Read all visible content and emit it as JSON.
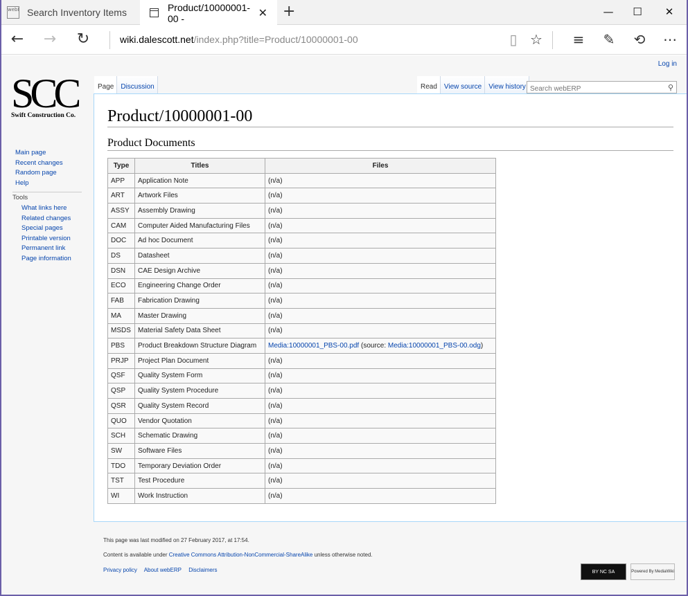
{
  "browser": {
    "tabs": [
      {
        "title": "Search Inventory Items",
        "favicon": "webERP"
      },
      {
        "title": "Product/10000001-00 -"
      }
    ],
    "address": {
      "host": "wiki.dalescott.net",
      "path": "/index.php?title=Product/10000001-00"
    }
  },
  "wiki": {
    "login": "Log in",
    "logo": {
      "big": "SCC",
      "small": "Swift Construction Co."
    },
    "nav": [
      "Main page",
      "Recent changes",
      "Random page",
      "Help"
    ],
    "tools_heading": "Tools",
    "tools": [
      "What links here",
      "Related changes",
      "Special pages",
      "Printable version",
      "Permanent link",
      "Page information"
    ],
    "left_tabs": [
      "Page",
      "Discussion"
    ],
    "right_tabs": [
      "Read",
      "View source",
      "View history"
    ],
    "search_placeholder": "Search webERP",
    "title": "Product/10000001-00",
    "section": "Product Documents",
    "table": {
      "headers": [
        "Type",
        "Titles",
        "Files"
      ],
      "rows": [
        {
          "type": "APP",
          "title": "Application Note",
          "files": "(n/a)"
        },
        {
          "type": "ART",
          "title": "Artwork Files",
          "files": "(n/a)"
        },
        {
          "type": "ASSY",
          "title": "Assembly Drawing",
          "files": "(n/a)"
        },
        {
          "type": "CAM",
          "title": "Computer Aided Manufacturing Files",
          "files": "(n/a)"
        },
        {
          "type": "DOC",
          "title": "Ad hoc Document",
          "files": "(n/a)"
        },
        {
          "type": "DS",
          "title": "Datasheet",
          "files": "(n/a)"
        },
        {
          "type": "DSN",
          "title": "CAE Design Archive",
          "files": "(n/a)"
        },
        {
          "type": "ECO",
          "title": "Engineering Change Order",
          "files": "(n/a)"
        },
        {
          "type": "FAB",
          "title": "Fabrication Drawing",
          "files": "(n/a)"
        },
        {
          "type": "MA",
          "title": "Master Drawing",
          "files": "(n/a)"
        },
        {
          "type": "MSDS",
          "title": "Material Safety Data Sheet",
          "files": "(n/a)"
        },
        {
          "type": "PBS",
          "title": "Product Breakdown Structure Diagram",
          "files": "",
          "link1": "Media:10000001_PBS-00.pdf",
          "mid": " (source: ",
          "link2": "Media:10000001_PBS-00.odg",
          "end": ")"
        },
        {
          "type": "PRJP",
          "title": "Project Plan Document",
          "files": "(n/a)"
        },
        {
          "type": "QSF",
          "title": "Quality System Form",
          "files": "(n/a)"
        },
        {
          "type": "QSP",
          "title": "Quality System Procedure",
          "files": "(n/a)"
        },
        {
          "type": "QSR",
          "title": "Quality System Record",
          "files": "(n/a)"
        },
        {
          "type": "QUO",
          "title": "Vendor Quotation",
          "files": "(n/a)"
        },
        {
          "type": "SCH",
          "title": "Schematic Drawing",
          "files": "(n/a)"
        },
        {
          "type": "SW",
          "title": "Software Files",
          "files": "(n/a)"
        },
        {
          "type": "TDO",
          "title": "Temporary Deviation Order",
          "files": "(n/a)"
        },
        {
          "type": "TST",
          "title": "Test Procedure",
          "files": "(n/a)"
        },
        {
          "type": "WI",
          "title": "Work Instruction",
          "files": "(n/a)"
        }
      ]
    },
    "footer": {
      "modified": "This page was last modified on 27 February 2017, at 17:54.",
      "content_prefix": "Content is available under ",
      "license": "Creative Commons Attribution-NonCommercial-ShareAlike",
      "content_suffix": " unless otherwise noted.",
      "links": [
        "Privacy policy",
        "About webERP",
        "Disclaimers"
      ],
      "cc_badge": "BY NC SA",
      "mw_badge": "Powered By MediaWiki"
    }
  }
}
